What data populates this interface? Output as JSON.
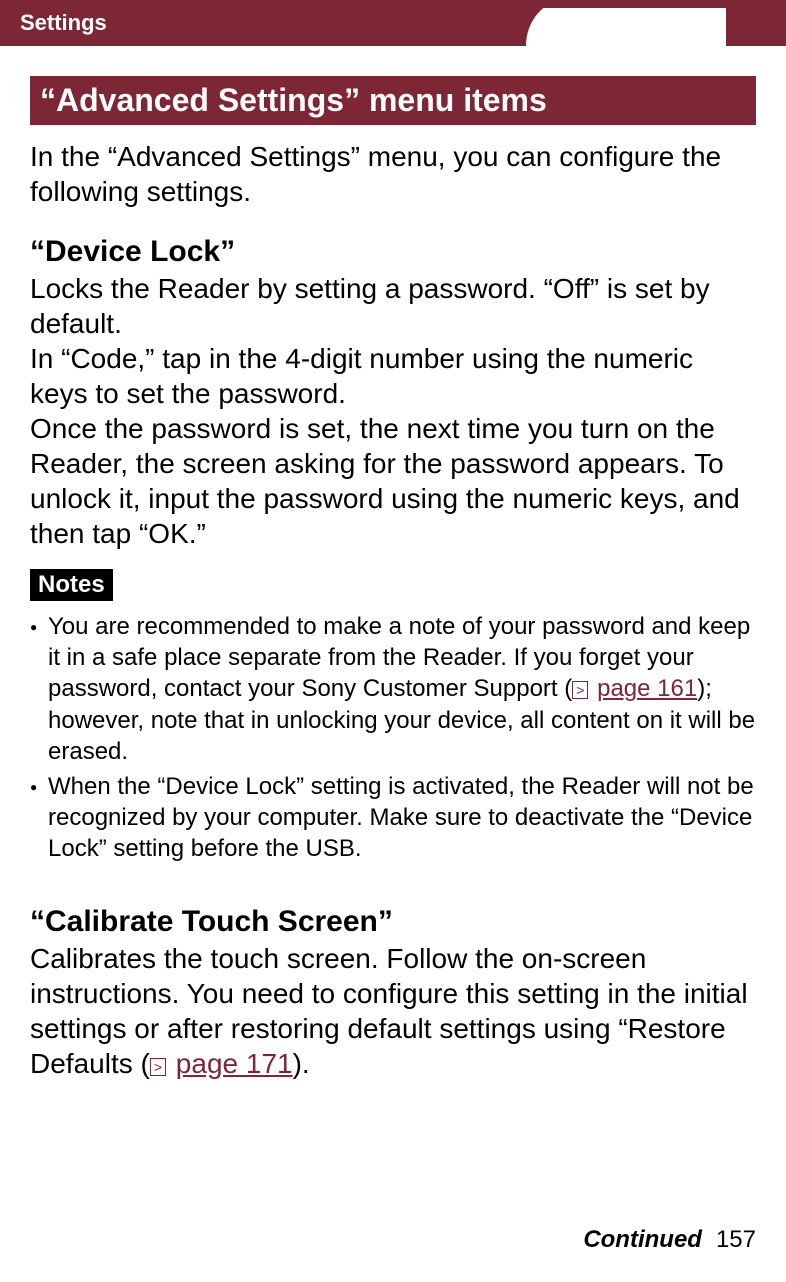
{
  "header": {
    "category": "Settings"
  },
  "section": {
    "title": "“Advanced Settings” menu items"
  },
  "intro": "In the “Advanced Settings” menu, you can configure the following settings.",
  "device_lock": {
    "heading": "“Device Lock”",
    "body": "Locks the Reader by setting a password. “Off” is set by default.\nIn “Code,” tap in the 4-digit number using the numeric keys to set the password.\nOnce the password is set, the next time you turn on the Reader, the screen asking for the password appears. To unlock it, input the password using the numeric keys, and then tap “OK.”"
  },
  "notes": {
    "label": "Notes",
    "items": [
      {
        "pre": "You are recommended to make a note of your password and keep it in a safe place separate from the Reader. If you forget your password, contact your Sony Customer Support (",
        "link": "page 161",
        "post": "); however, note that in unlocking your device, all content on it will be erased."
      },
      {
        "pre": "When the “Device Lock” setting is activated, the Reader will not be recognized by your computer. Make sure to deactivate the “Device Lock” setting before the USB.",
        "link": "",
        "post": ""
      }
    ]
  },
  "calibrate": {
    "heading": "“Calibrate Touch Screen”",
    "body_pre": "Calibrates the touch screen. Follow the on-screen instructions. You need to configure this setting in the initial settings or after restoring default settings using “Restore Defaults (",
    "link": "page 171",
    "body_post": ")."
  },
  "footer": {
    "continued": "Continued",
    "page": "157"
  }
}
